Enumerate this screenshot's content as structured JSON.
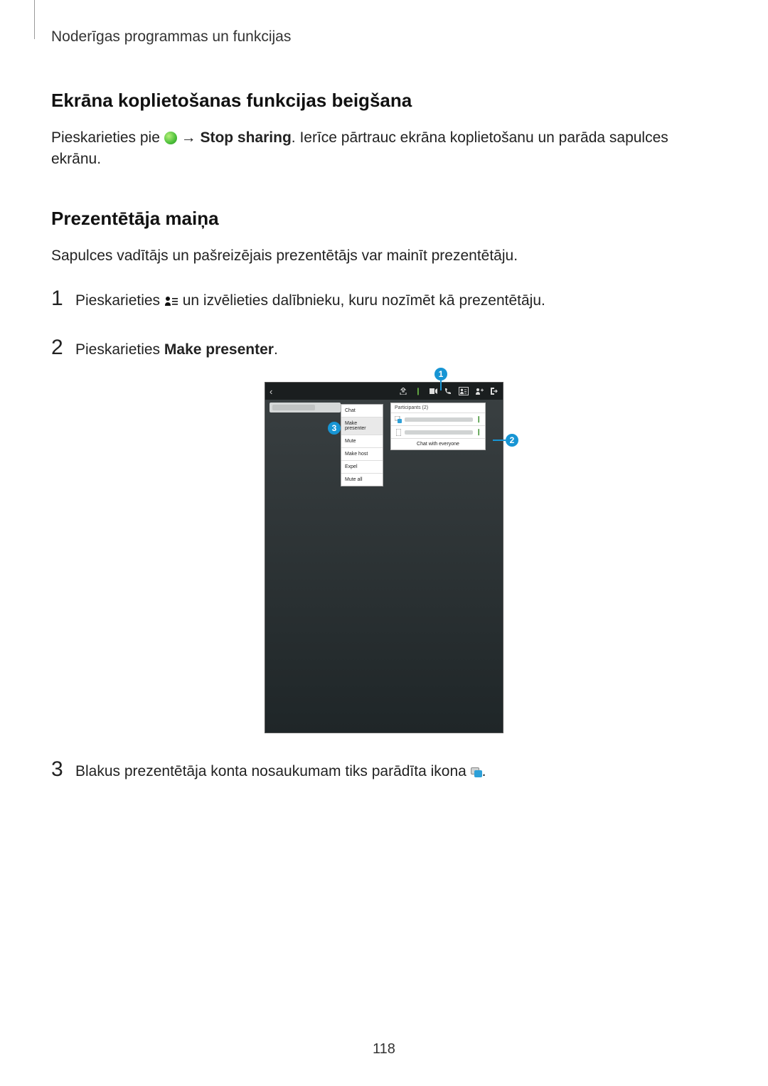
{
  "header": "Noderīgas programmas un funkcijas",
  "section1": {
    "title": "Ekrāna koplietošanas funkcijas beigšana",
    "para_pre": "Pieskarieties pie ",
    "para_arrow": " → ",
    "para_bold": "Stop sharing",
    "para_post": ". Ierīce pārtrauc ekrāna koplietošanu un parāda sapulces ekrānu."
  },
  "section2": {
    "title": "Prezentētāja maiņa",
    "intro": "Sapulces vadītājs un pašreizējais prezentētājs var mainīt prezentētāju.",
    "steps": [
      {
        "num": "1",
        "text_pre": "Pieskarieties ",
        "text_post": " un izvēlieties dalībnieku, kuru nozīmēt kā prezentētāju."
      },
      {
        "num": "2",
        "text_pre": "Pieskarieties ",
        "bold": "Make presenter",
        "text_post": "."
      },
      {
        "num": "3",
        "text_pre": "Blakus prezentētāja konta nosaukumam tiks parādīta ikona ",
        "text_post": "."
      }
    ]
  },
  "figure": {
    "context_menu": [
      "Chat",
      "Make presenter",
      "Mute",
      "Make host",
      "Expel",
      "Mute all"
    ],
    "participants_header": "Participants (2)",
    "chat_button": "Chat with everyone",
    "callouts": {
      "c1": "1",
      "c2": "2",
      "c3": "3"
    }
  },
  "page_number": "118"
}
